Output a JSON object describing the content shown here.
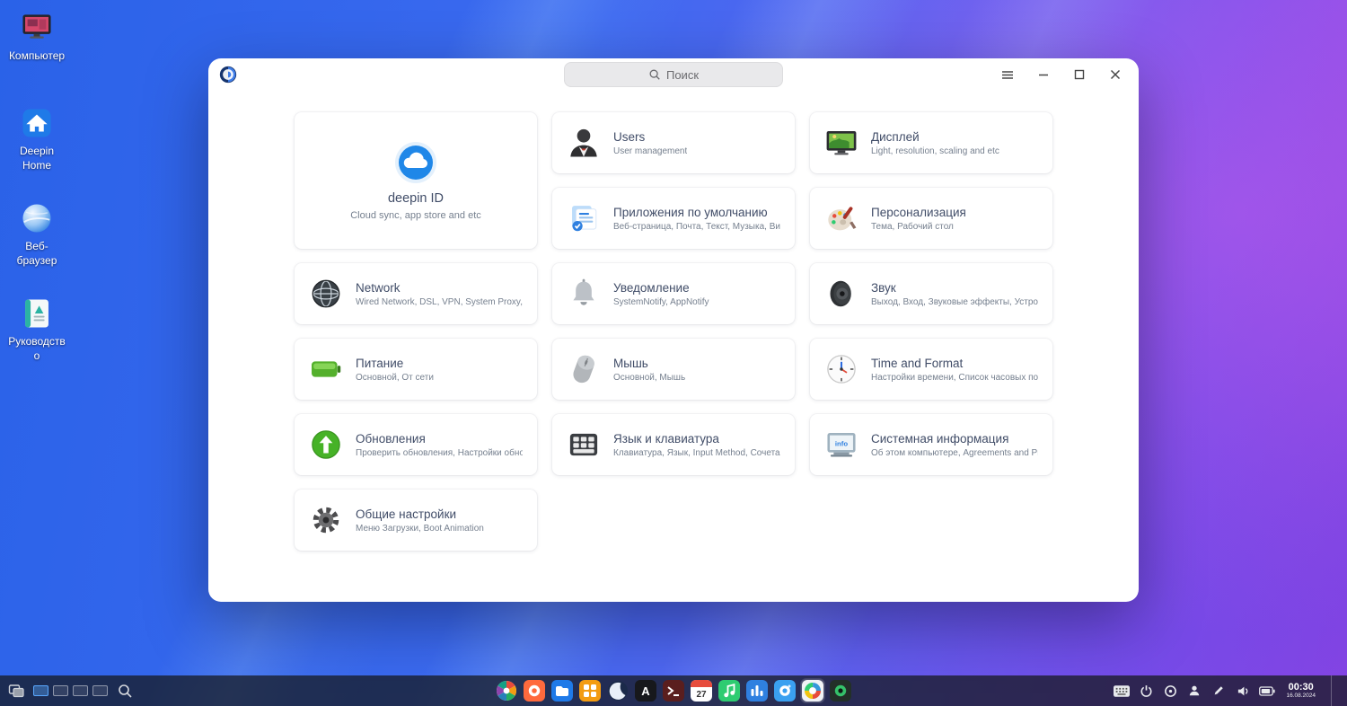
{
  "desktop": {
    "icons": [
      {
        "id": "computer",
        "label": "Компьютер"
      },
      {
        "id": "deepin-home",
        "label": "Deepin Home"
      },
      {
        "id": "web-browser",
        "label": "Веб-браузер"
      },
      {
        "id": "manual",
        "label": "Руководство"
      }
    ]
  },
  "window": {
    "search_placeholder": "Поиск",
    "cards": [
      {
        "id": "deepin-id",
        "size": "large",
        "title": "deepin ID",
        "subtitle": "Cloud sync, app store and etc"
      },
      {
        "id": "users",
        "title": "Users",
        "subtitle": "User management"
      },
      {
        "id": "display",
        "title": "Дисплей",
        "subtitle": "Light, resolution, scaling and etc"
      },
      {
        "id": "default-apps",
        "title": "Приложения по умолчанию",
        "subtitle": "Веб-страница, Почта, Текст, Музыка, Виде..."
      },
      {
        "id": "personalization",
        "title": "Персонализация",
        "subtitle": "Тема, Рабочий стол"
      },
      {
        "id": "network",
        "title": "Network",
        "subtitle": "Wired Network, DSL, VPN, System Proxy, Net..."
      },
      {
        "id": "notification",
        "title": "Уведомление",
        "subtitle": "SystemNotify, AppNotify"
      },
      {
        "id": "sound",
        "title": "Звук",
        "subtitle": "Выход, Вход, Звуковые эффекты, Устройст..."
      },
      {
        "id": "power",
        "title": "Питание",
        "subtitle": "Основной, От сети"
      },
      {
        "id": "mouse",
        "title": "Мышь",
        "subtitle": "Основной, Мышь"
      },
      {
        "id": "time-format",
        "title": "Time and Format",
        "subtitle": "Настройки времени, Список часовых пояс..."
      },
      {
        "id": "updates",
        "title": "Обновления",
        "subtitle": "Проверить обновления, Настройки обнов..."
      },
      {
        "id": "keyboard",
        "title": "Язык и клавиатура",
        "subtitle": "Клавиатура, Язык, Input Method, Сочетани..."
      },
      {
        "id": "system-info",
        "title": "Системная информация",
        "subtitle": "Об этом компьютере, Agreements and Priva..."
      },
      {
        "id": "general",
        "title": "Общие настройки",
        "subtitle": "Меню Загрузки, Boot Animation"
      }
    ]
  },
  "taskbar": {
    "workspaces": {
      "count": 4,
      "active": 1
    },
    "dock": [
      {
        "id": "launcher"
      },
      {
        "id": "app-store"
      },
      {
        "id": "file-manager"
      },
      {
        "id": "app-market"
      },
      {
        "id": "browser"
      },
      {
        "id": "text-editor"
      },
      {
        "id": "terminal"
      },
      {
        "id": "calendar",
        "badge": "27"
      },
      {
        "id": "music"
      },
      {
        "id": "video-player"
      },
      {
        "id": "photos"
      },
      {
        "id": "control-center",
        "active": true
      },
      {
        "id": "screen-capture"
      }
    ],
    "tray": [
      {
        "id": "keyboard-layout"
      },
      {
        "id": "power"
      },
      {
        "id": "notification"
      },
      {
        "id": "onboard"
      },
      {
        "id": "pen"
      },
      {
        "id": "volume"
      },
      {
        "id": "battery"
      }
    ],
    "clock": {
      "time": "00:30",
      "date": "16.08.2024"
    }
  }
}
